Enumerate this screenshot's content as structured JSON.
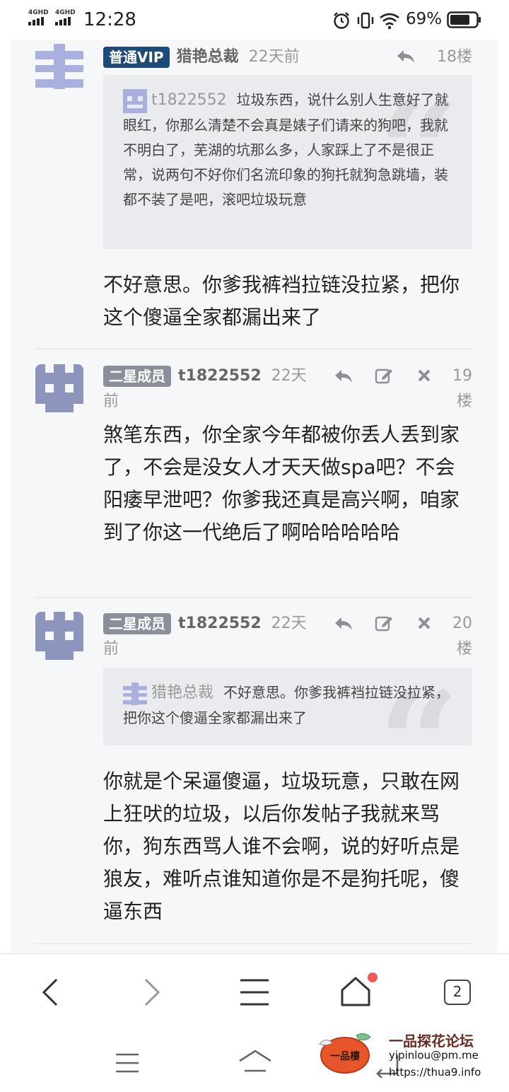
{
  "status_bar": {
    "signal1": "4GHD",
    "signal2": "4GHD",
    "time": "12:28",
    "battery": "69%"
  },
  "posts": [
    {
      "badge": "普通VIP",
      "author": "猎艳总裁",
      "time": "22天前",
      "floor": "18楼",
      "quote_author": "t1822552",
      "quote_text": "垃圾东西，说什么别人生意好了就眼红，你那么清楚不会真是婊子们请来的狗吧，我就不明白了，芜湖的坑那么多，人家踩上了不是很正常，说两句不好你们名流印象的狗托就狗急跳墙，装都不装了是吧，滚吧垃圾玩意",
      "body": "不好意思。你爹我裤裆拉链没拉紧，把你这个傻逼全家都漏出来了"
    },
    {
      "badge": "二星成员",
      "author": "t1822552",
      "time_a": "22天",
      "time_b": "前",
      "floor_a": "19",
      "floor_b": "楼",
      "body": "煞笔东西，你全家今年都被你丢人丢到家了，不会是没女人才天天做spa吧？不会阳痿早泄吧？你爹我还真是高兴啊，咱家到了你这一代绝后了啊哈哈哈哈哈"
    },
    {
      "badge": "二星成员",
      "author": "t1822552",
      "time_a": "22天",
      "time_b": "前",
      "floor_a": "20",
      "floor_b": "楼",
      "quote_author": "猎艳总裁",
      "quote_text": "不好意思。你爹我裤裆拉链没拉紧，把你这个傻逼全家都漏出来了",
      "body": "你就是个呆逼傻逼，垃圾玩意，只敢在网上狂吠的垃圾，以后你发帖子我就来骂你，狗东西骂人谁不会啊，说的好听点是狼友，难听点谁知道你是不是狗托呢，傻逼东西"
    }
  ],
  "browser_nav": {
    "tab_count": "2"
  },
  "watermark": {
    "title": "一品探花论坛",
    "email": "yipinlou@pm.me",
    "url": "https://thua9.info",
    "logo_text": "一品樓"
  },
  "colors": {
    "vip_badge": "#1e4a78",
    "star_badge": "#8a8f99",
    "notification_dot": "#f25a5a"
  }
}
